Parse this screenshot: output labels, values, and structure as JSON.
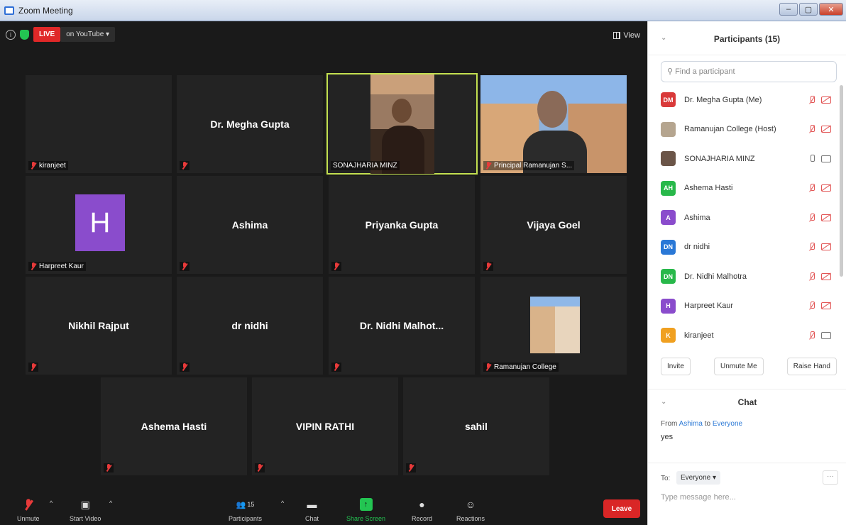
{
  "window": {
    "title": "Zoom Meeting"
  },
  "top": {
    "live": "LIVE",
    "youtube": "on YouTube ▾",
    "view": "View"
  },
  "tiles": {
    "kiranjeet": "kiranjeet",
    "megha": "Dr. Megha Gupta",
    "sona": "SONAJHARIA MINZ",
    "principal": "Principal Ramanujan S...",
    "harpreet_label": "Harpreet Kaur",
    "harpreet_initial": "H",
    "ashima": "Ashima",
    "priyanka": "Priyanka Gupta",
    "vijaya": "Vijaya Goel",
    "nikhil": "Nikhil Rajput",
    "drnidhi": "dr nidhi",
    "nidhi_malhot": "Dr. Nidhi  Malhot...",
    "ramanujan": "Ramanujan College",
    "ashema": "Ashema Hasti",
    "vipin": "VIPIN RATHI",
    "sahil": "sahil"
  },
  "toolbar": {
    "unmute": "Unmute",
    "start_video": "Start Video",
    "participants": "Participants",
    "participants_count": "15",
    "chat": "Chat",
    "share": "Share Screen",
    "record": "Record",
    "reactions": "Reactions",
    "leave": "Leave"
  },
  "panel": {
    "title": "Participants (15)",
    "search_placeholder": "Find a participant",
    "participants": [
      {
        "initials": "DM",
        "name": "Dr. Megha Gupta (Me)",
        "color": "#d93a3a"
      },
      {
        "initials": "",
        "name": "Ramanujan College (Host)",
        "color": "#b5a58f"
      },
      {
        "initials": "",
        "name": "SONAJHARIA MINZ",
        "color": "#6b5548"
      },
      {
        "initials": "AH",
        "name": "Ashema Hasti",
        "color": "#28b84a"
      },
      {
        "initials": "A",
        "name": "Ashima",
        "color": "#8a4ccc"
      },
      {
        "initials": "DN",
        "name": "dr nidhi",
        "color": "#2a78d6"
      },
      {
        "initials": "DN",
        "name": "Dr. Nidhi Malhotra",
        "color": "#28b84a"
      },
      {
        "initials": "H",
        "name": "Harpreet Kaur",
        "color": "#8a4ccc"
      },
      {
        "initials": "K",
        "name": "kiranjeet",
        "color": "#f0a020"
      }
    ],
    "invite": "Invite",
    "unmute_me": "Unmute Me",
    "raise_hand": "Raise Hand"
  },
  "chat": {
    "title": "Chat",
    "from_prefix": "From",
    "from_name": "Ashima",
    "to_word": "to",
    "to_target": "Everyone",
    "message": "yes",
    "to_label": "To:",
    "to_select": "Everyone ▾",
    "placeholder": "Type message here..."
  }
}
